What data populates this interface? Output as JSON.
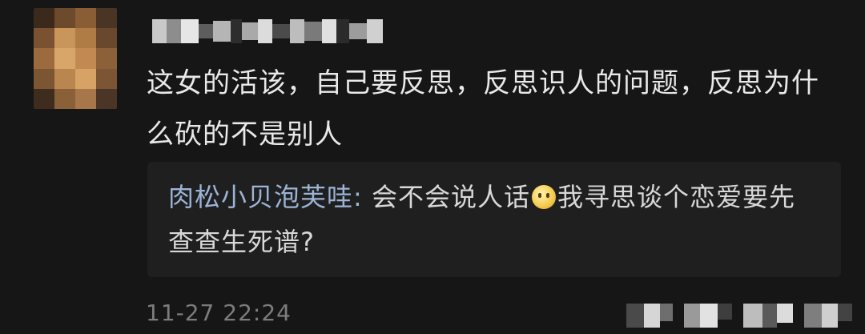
{
  "comment": {
    "text": "这女的活该，自己要反思，反思识人的问题，反思为什么砍的不是别人",
    "timestamp": "11-27 22:24"
  },
  "reply": {
    "author": "肉松小贝泡芙哇:",
    "text_before_emoji": " 会不会说人话",
    "emoji": "thinking-emoji",
    "text_after_emoji": "我寻思谈个恋爱要先查查生死谱?"
  },
  "colors": {
    "background": "#161616",
    "reply_background": "#1f1f1f",
    "reply_author": "#9bb4d6",
    "body_text": "#e9e9e9",
    "muted": "#7d7d7d"
  }
}
